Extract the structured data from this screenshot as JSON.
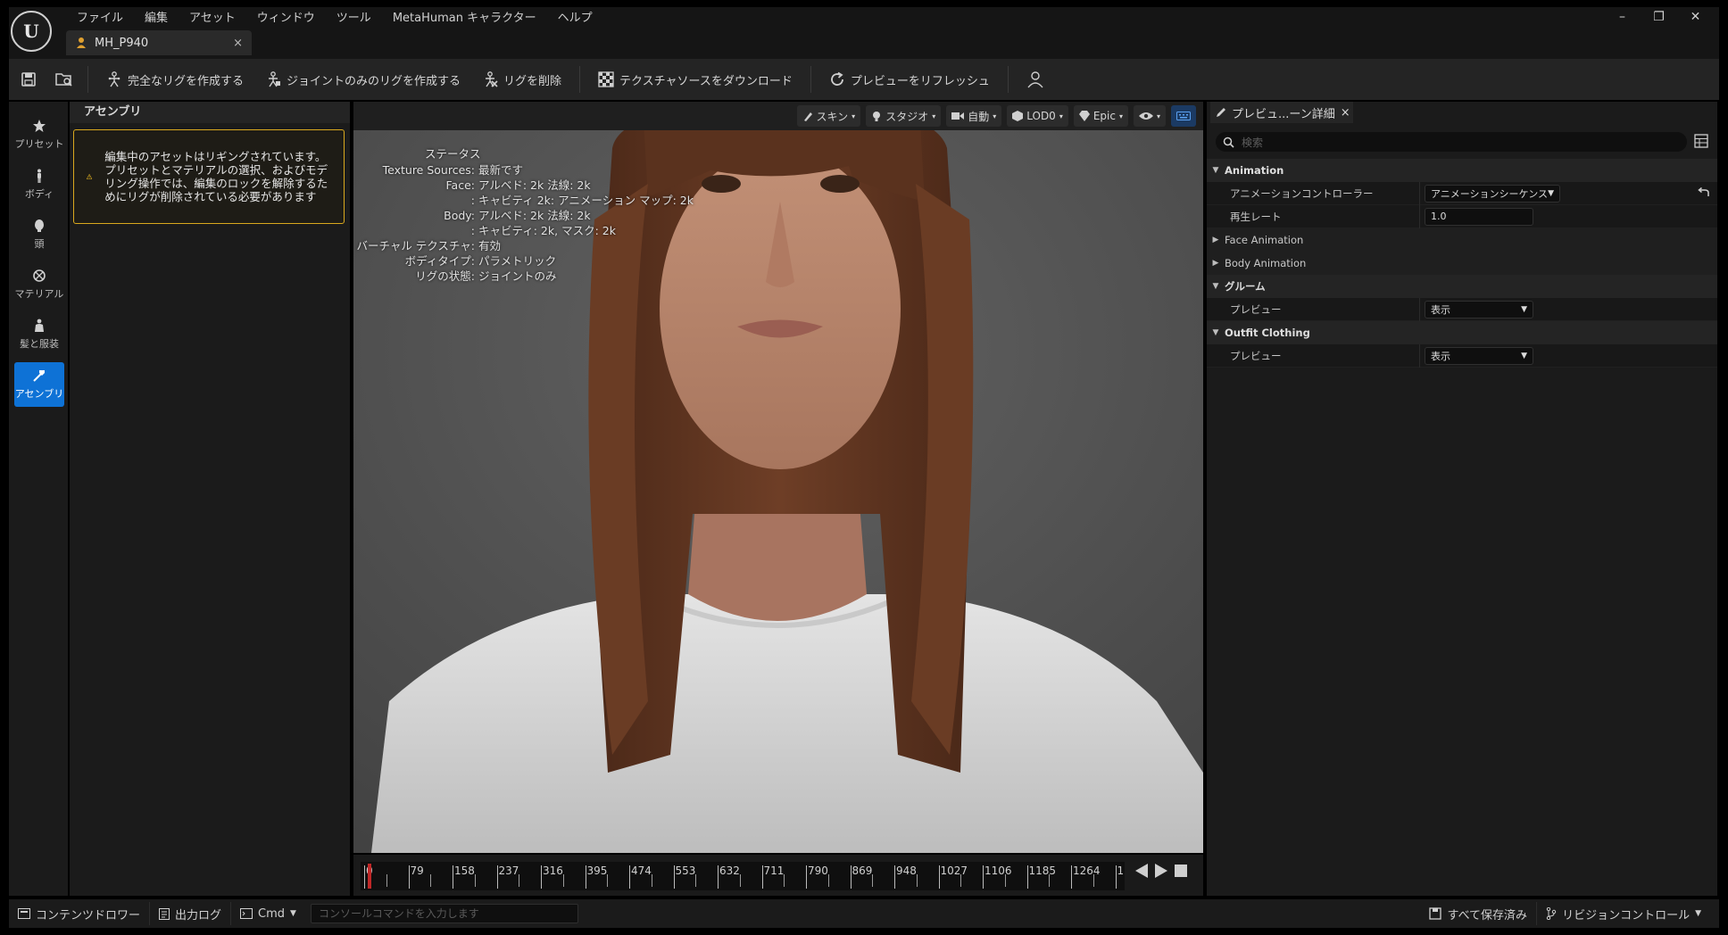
{
  "app": {
    "logo": "U",
    "document_tab": "MH_P940",
    "close_glyph": "×"
  },
  "menu": [
    "ファイル",
    "編集",
    "アセット",
    "ウィンドウ",
    "ツール",
    "MetaHuman キャラクター",
    "ヘルプ"
  ],
  "window_controls": {
    "minimize": "–",
    "restore": "❐",
    "close": "✕"
  },
  "toolbar": {
    "create_full_rig": "完全なリグを作成する",
    "create_joint_rig": "ジョイントのみのリグを作成する",
    "remove_rig": "リグを削除",
    "download_texture": "テクスチャソースをダウンロード",
    "refresh_preview": "プレビューをリフレッシュ"
  },
  "modes": [
    {
      "label": "プリセット",
      "icon": "star-icon"
    },
    {
      "label": "ボディ",
      "icon": "body-icon"
    },
    {
      "label": "頭",
      "icon": "head-icon"
    },
    {
      "label": "マテリアル",
      "icon": "material-icon"
    },
    {
      "label": "髪と服装",
      "icon": "hair-clothing-icon"
    },
    {
      "label": "アセンブリ",
      "icon": "hammer-icon"
    }
  ],
  "assembly": {
    "title": "アセンブリ",
    "warning": "編集中のアセットはリギングされています。プリセットとマテリアルの選択、およびモデリング操作では、編集のロックを解除するためにリグが削除されている必要があります"
  },
  "viewport": {
    "buttons": {
      "skin": "スキン",
      "studio": "スタジオ",
      "auto": "自動",
      "lod": "LOD0",
      "quality": "Epic"
    },
    "stats": {
      "title": "ステータス",
      "rows": [
        {
          "k": "Texture Sources:",
          "v": "最新です"
        },
        {
          "k": "Face:",
          "v": "アルベド: 2k 法線: 2k"
        },
        {
          "k": ":",
          "v": "キャビティ 2k: アニメーション マップ: 2k"
        },
        {
          "k": "Body:",
          "v": "アルベド: 2k 法線: 2k"
        },
        {
          "k": ":",
          "v": "キャビティ: 2k, マスク: 2k"
        },
        {
          "k": "バーチャル テクスチャ:",
          "v": "有効"
        },
        {
          "k": "ボディタイプ:",
          "v": "パラメトリック"
        },
        {
          "k": "リグの状態:",
          "v": "ジョイントのみ"
        }
      ]
    }
  },
  "timeline": {
    "ticks": [
      "0",
      "79",
      "158",
      "237",
      "316",
      "395",
      "474",
      "553",
      "632",
      "711",
      "790",
      "869",
      "948",
      "1027",
      "1106",
      "1185",
      "1264",
      "1"
    ]
  },
  "details": {
    "tab_title": "プレビュ...ーン詳細",
    "search_placeholder": "検索",
    "animation_cat": "Animation",
    "anim_controller_label": "アニメーションコントローラー",
    "anim_controller_value": "アニメーションシーケンス",
    "playrate_label": "再生レート",
    "playrate_value": "1.0",
    "face_animation": "Face Animation",
    "body_animation": "Body Animation",
    "groom_cat": "グルーム",
    "groom_preview_label": "プレビュー",
    "groom_preview_value": "表示",
    "outfit_cat": "Outfit Clothing",
    "outfit_preview_label": "プレビュー",
    "outfit_preview_value": "表示"
  },
  "statusbar": {
    "content_drawer": "コンテンツドロワー",
    "output_log": "出力ログ",
    "cmd": "Cmd",
    "console_placeholder": "コンソールコマンドを入力します",
    "save_all": "すべて保存済み",
    "revision_control": "リビジョンコントロール"
  }
}
